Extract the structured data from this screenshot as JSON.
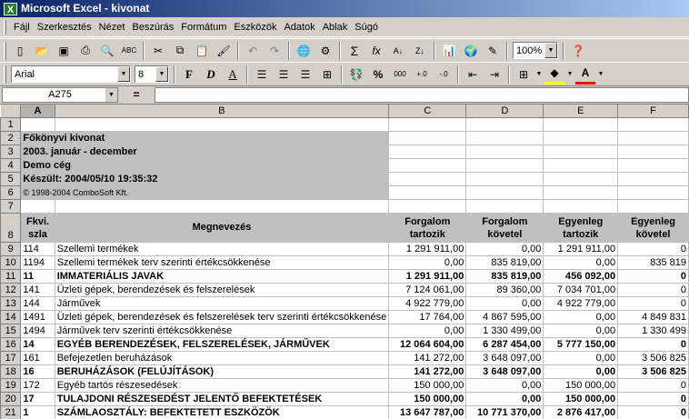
{
  "window": {
    "title": "Microsoft Excel - kivonat"
  },
  "menu": [
    "Fájl",
    "Szerkesztés",
    "Nézet",
    "Beszúrás",
    "Formátum",
    "Eszközök",
    "Adatok",
    "Ablak",
    "Súgó"
  ],
  "toolbar": {
    "zoom": "100%",
    "sum_label": "Σ",
    "fx_label": "fx"
  },
  "format_toolbar": {
    "font": "Arial",
    "size": "8",
    "bold": "F",
    "italic": "D",
    "underline": "A",
    "percent": "%",
    "thousands": "000"
  },
  "formula_bar": {
    "name_box": "A275",
    "equals": "=",
    "value": ""
  },
  "columns": [
    "A",
    "B",
    "C",
    "D",
    "E",
    "F"
  ],
  "info": {
    "line1": "Főkönyvi kivonat",
    "line2": "2003. január - december",
    "line3": "Demo cég",
    "line4": "Készült: 2004/05/10 19:35:32",
    "line5": "© 1998-2004 ComboSoft Kft."
  },
  "headers": {
    "fkvi": "Fkvi.",
    "szla": "szla",
    "megnevezes": "Megnevezés",
    "forg_t1": "Forgalom",
    "forg_t2": "tartozik",
    "forg_k1": "Forgalom",
    "forg_k2": "követel",
    "egy_t1": "Egyenleg",
    "egy_t2": "tartozik",
    "egy_k1": "Egyenleg",
    "egy_k2": "követel"
  },
  "rows": [
    {
      "n": "9",
      "a": "114",
      "b": "Szellemi termékek",
      "c": "1 291 911,00",
      "d": "0,00",
      "e": "1 291 911,00",
      "f": "0",
      "bold": false
    },
    {
      "n": "10",
      "a": "1194",
      "b": "Szellemi termékek terv szerinti értékcsökkenése",
      "c": "0,00",
      "d": "835 819,00",
      "e": "0,00",
      "f": "835 819",
      "bold": false
    },
    {
      "n": "11",
      "a": "11",
      "b": "IMMATERIÁLIS JAVAK",
      "c": "1 291 911,00",
      "d": "835 819,00",
      "e": "456 092,00",
      "f": "0",
      "bold": true
    },
    {
      "n": "12",
      "a": "141",
      "b": "Üzleti gépek, berendezések és felszerelések",
      "c": "7 124 061,00",
      "d": "89 360,00",
      "e": "7 034 701,00",
      "f": "0",
      "bold": false
    },
    {
      "n": "13",
      "a": "144",
      "b": "Járművek",
      "c": "4 922 779,00",
      "d": "0,00",
      "e": "4 922 779,00",
      "f": "0",
      "bold": false
    },
    {
      "n": "14",
      "a": "1491",
      "b": "Üzleti gépek, berendezések és felszerelések terv szerinti értékcsökkenése",
      "c": "17 764,00",
      "d": "4 867 595,00",
      "e": "0,00",
      "f": "4 849 831",
      "bold": false
    },
    {
      "n": "15",
      "a": "1494",
      "b": "Járművek terv szerinti értékcsökkenése",
      "c": "0,00",
      "d": "1 330 499,00",
      "e": "0,00",
      "f": "1 330 499",
      "bold": false
    },
    {
      "n": "16",
      "a": "14",
      "b": "EGYÉB BERENDEZÉSEK, FELSZERELÉSEK, JÁRMŰVEK",
      "c": "12 064 604,00",
      "d": "6 287 454,00",
      "e": "5 777 150,00",
      "f": "0",
      "bold": true
    },
    {
      "n": "17",
      "a": "161",
      "b": "Befejezetlen beruházások",
      "c": "141 272,00",
      "d": "3 648 097,00",
      "e": "0,00",
      "f": "3 506 825",
      "bold": false
    },
    {
      "n": "18",
      "a": "16",
      "b": "BERUHÁZÁSOK (FELÚJÍTÁSOK)",
      "c": "141 272,00",
      "d": "3 648 097,00",
      "e": "0,00",
      "f": "3 506 825",
      "bold": true
    },
    {
      "n": "19",
      "a": "172",
      "b": "Egyéb tartós részesedések",
      "c": "150 000,00",
      "d": "0,00",
      "e": "150 000,00",
      "f": "0",
      "bold": false
    },
    {
      "n": "20",
      "a": "17",
      "b": "TULAJDONI RÉSZESEDÉST JELENTŐ BEFEKTETÉSEK",
      "c": "150 000,00",
      "d": "0,00",
      "e": "150 000,00",
      "f": "0",
      "bold": true
    },
    {
      "n": "21",
      "a": "1",
      "b": "SZÁMLAOSZTÁLY: BEFEKTETETT ESZKÖZÖK",
      "c": "13 647 787,00",
      "d": "10 771 370,00",
      "e": "2 876 417,00",
      "f": "0",
      "bold": true
    }
  ],
  "row_numbers": [
    "1",
    "2",
    "3",
    "4",
    "5",
    "6",
    "7",
    "8"
  ]
}
